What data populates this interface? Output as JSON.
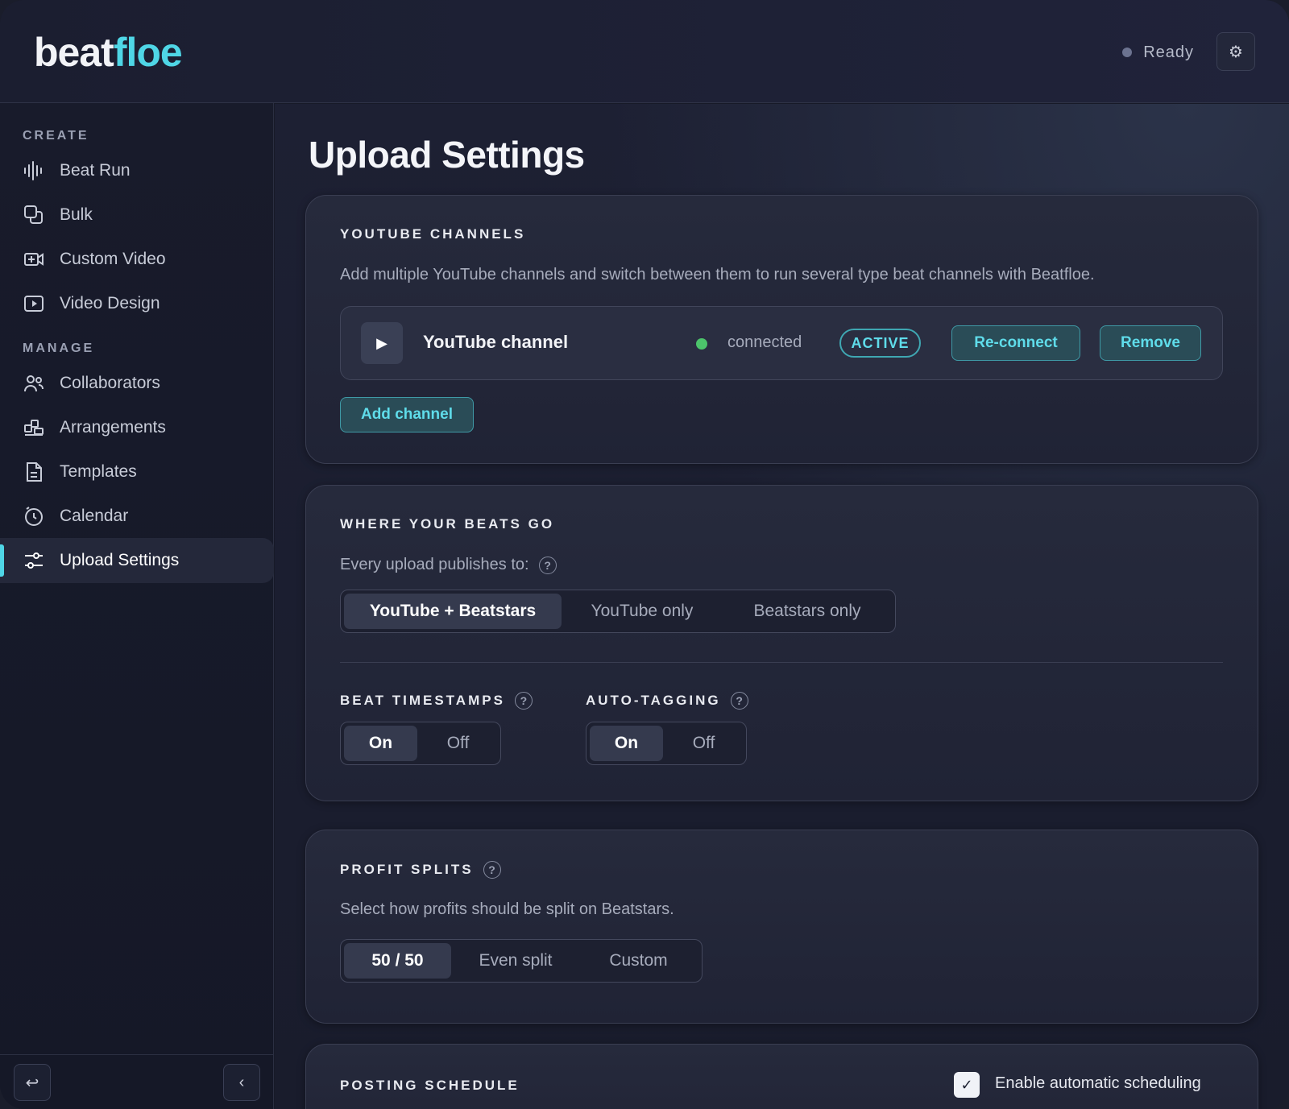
{
  "header": {
    "logo_part1": "beat",
    "logo_part2": "floe",
    "status": "Ready",
    "settings_icon": "gear-icon"
  },
  "sidebar": {
    "create_label": "CREATE",
    "manage_label": "MANAGE",
    "create_items": [
      {
        "label": "Beat Run",
        "icon": "waveform-icon"
      },
      {
        "label": "Bulk",
        "icon": "stack-icon"
      },
      {
        "label": "Custom Video",
        "icon": "video-add-icon"
      },
      {
        "label": "Video Design",
        "icon": "play-box-icon"
      }
    ],
    "manage_items": [
      {
        "label": "Collaborators",
        "icon": "users-icon"
      },
      {
        "label": "Arrangements",
        "icon": "blocks-icon"
      },
      {
        "label": "Templates",
        "icon": "document-icon"
      },
      {
        "label": "Calendar",
        "icon": "clock-icon"
      },
      {
        "label": "Upload Settings",
        "icon": "sliders-icon",
        "active": true
      }
    ]
  },
  "main": {
    "title": "Upload Settings",
    "youtube": {
      "title": "YOUTUBE CHANNELS",
      "description": "Add multiple YouTube channels and switch between them to run several type beat channels with Beatfloe.",
      "channel": {
        "name": "YouTube channel",
        "status": "connected",
        "badge": "ACTIVE",
        "reconnect": "Re-connect",
        "remove": "Remove"
      },
      "add_channel": "Add channel"
    },
    "destination": {
      "title": "WHERE YOUR BEATS GO",
      "prompt": "Every upload publishes to:",
      "options": [
        "YouTube + Beatstars",
        "YouTube only",
        "Beatstars only"
      ],
      "selected": 0,
      "timestamps": {
        "title": "BEAT TIMESTAMPS",
        "on": "On",
        "off": "Off"
      },
      "autotag": {
        "title": "AUTO-TAGGING",
        "on": "On",
        "off": "Off"
      }
    },
    "profit": {
      "title": "PROFIT SPLITS",
      "description": "Select how profits should be split on Beatstars.",
      "options": [
        "50 / 50",
        "Even split",
        "Custom"
      ],
      "selected": 0
    },
    "schedule": {
      "title": "POSTING SCHEDULE",
      "checkbox_label": "Enable automatic scheduling",
      "checked": true
    }
  }
}
